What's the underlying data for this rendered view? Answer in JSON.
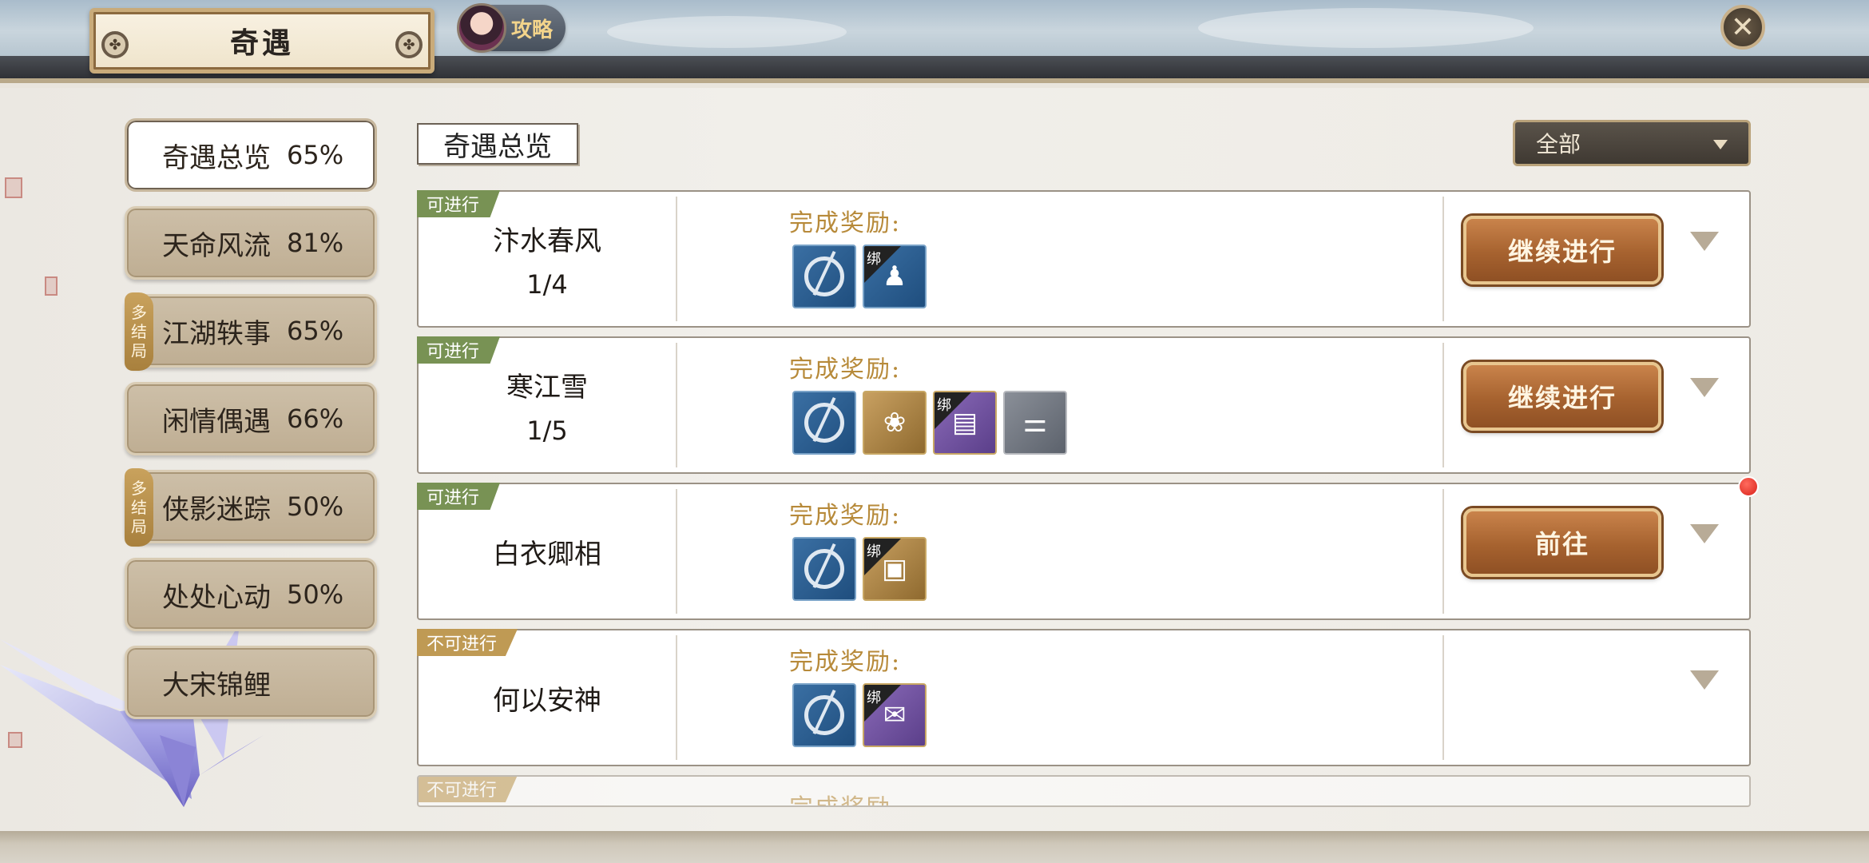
{
  "header": {
    "title": "奇遇",
    "guide_label": "攻略",
    "close_symbol": "✕"
  },
  "sidebar": {
    "items": [
      {
        "label": "奇遇总览",
        "pct": "65%",
        "active": true
      },
      {
        "label": "天命风流",
        "pct": "81%"
      },
      {
        "label": "江湖轶事",
        "pct": "65%",
        "badge": "多结局"
      },
      {
        "label": "闲情偶遇",
        "pct": "66%"
      },
      {
        "label": "侠影迷踪",
        "pct": "50%",
        "badge": "多结局"
      },
      {
        "label": "处处心动",
        "pct": "50%"
      },
      {
        "label": "大宋锦鲤",
        "pct": ""
      }
    ],
    "badge_chars": [
      "多",
      "结",
      "局"
    ]
  },
  "main": {
    "section_title": "奇遇总览",
    "filter_value": "全部",
    "reward_label": "完成奖励:",
    "bind_char": "绑",
    "cards": [
      {
        "status": "可进行",
        "name": "汴水春风",
        "progress": "1/4",
        "action": "继续进行"
      },
      {
        "status": "可进行",
        "name": "寒江雪",
        "progress": "1/5",
        "action": "继续进行"
      },
      {
        "status": "可进行",
        "name": "白衣卿相",
        "progress": "",
        "action": "前往"
      },
      {
        "status": "不可进行",
        "name": "何以安神",
        "progress": "",
        "action": ""
      },
      {
        "status": "不可进行",
        "name": "",
        "progress": "",
        "action": ""
      }
    ]
  },
  "colors": {
    "accent_button": "#a6622f",
    "available_tag": "#789254",
    "unavailable_tag": "#bf9a54",
    "reward_label": "#b78a3a"
  }
}
